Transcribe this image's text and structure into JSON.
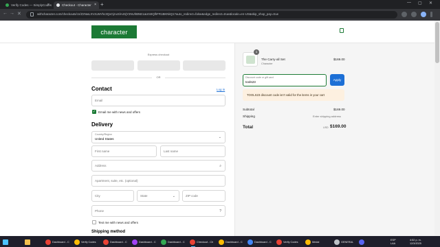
{
  "browser": {
    "tabs": [
      {
        "title": "Verify Codes — SimplyCodes",
        "active": false
      },
      {
        "title": "Checkout - Character",
        "active": true
      }
    ],
    "url": "withcharacter.com/checkouts/cn/Z2NwLXVzLWVhc3QxOjAxSlA4SjY2NUhBNE1aU04tQlhFR1BKNkQ1?auto_redirect=false&edge_redirect=true&locale=en-US&skip_shop_pay=true"
  },
  "header": {
    "logo": "character"
  },
  "checkout": {
    "express_label": "Express checkout",
    "or_label": "OR",
    "contact": {
      "heading": "Contact",
      "login_link": "Log in",
      "email_placeholder": "Email",
      "email_news_label": "Email me with news and offers",
      "email_news_checked": true
    },
    "delivery": {
      "heading": "Delivery",
      "country_label": "Country/Region",
      "country_value": "United States",
      "first_name": "First name",
      "last_name": "Last name",
      "address": "Address",
      "apartment": "Apartment, suite, etc. (optional)",
      "city": "City",
      "state": "State",
      "zip": "ZIP code",
      "phone": "Phone",
      "text_news_label": "Text me with news and offers"
    },
    "shipping_heading": "Shipping method"
  },
  "summary": {
    "item": {
      "name": "The Carry-all Set",
      "brand": "Character",
      "price": "$169.00",
      "quantity": "1"
    },
    "discount": {
      "label": "Discount code or gift card",
      "value": "tools23",
      "apply": "Apply"
    },
    "error": "TOOLS23 discount code isn't valid for the items in your cart",
    "subtotal_label": "Subtotal",
    "subtotal_value": "$169.00",
    "shipping_label": "Shipping",
    "shipping_value": "Enter shipping address",
    "total_label": "Total",
    "currency": "USD",
    "total_value": "$169.00"
  },
  "taskbar": {
    "items": [
      "Dashboard - C",
      "Verify Codes",
      "Dashboard - C",
      "Dashboard - C",
      "Dashboard - C",
      "Checkout - Ch",
      "Dashboard - C",
      "Dashboard - C",
      "Verify Codes",
      "Medal",
      "GENERAL"
    ],
    "lang": "ESP",
    "lang2": "LAA",
    "time": "4:52 p. m.",
    "date": "12/3/2025"
  },
  "colors": {
    "brand": "#1c7a35",
    "apply": "#1c6fd6",
    "alert_bg": "#fdf0e0"
  }
}
